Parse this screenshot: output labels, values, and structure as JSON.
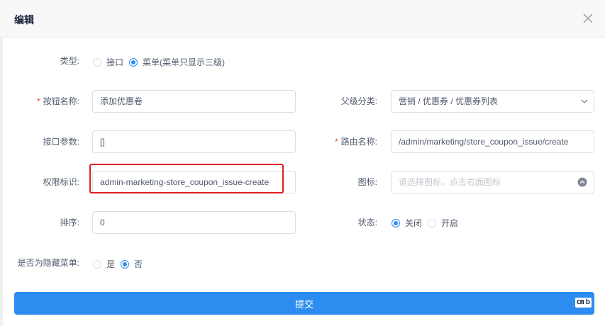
{
  "dialog": {
    "title": "编辑"
  },
  "form": {
    "type": {
      "label": "类型:",
      "options": [
        {
          "label": "接口",
          "selected": false
        },
        {
          "label": "菜单(菜单只显示三级)",
          "selected": true
        }
      ]
    },
    "button_name": {
      "label": "按钮名称:",
      "required": "*",
      "value": "添加优惠卷"
    },
    "parent_category": {
      "label": "父级分类:",
      "value": "营销 / 优惠券 / 优惠券列表"
    },
    "api_params": {
      "label": "接口参数:",
      "value": "[]"
    },
    "route_name": {
      "label": "路由名称:",
      "required": "*",
      "value": "/admin/marketing/store_coupon_issue/create"
    },
    "permission": {
      "label": "权限标识:",
      "value": "admin-marketing-store_coupon_issue-create"
    },
    "icon": {
      "label": "图标:",
      "placeholder": "请选择图标，点击右面图标"
    },
    "sort": {
      "label": "排序:",
      "value": "0"
    },
    "status": {
      "label": "状态:",
      "options": [
        {
          "label": "关闭",
          "selected": true
        },
        {
          "label": "开启",
          "selected": false
        }
      ]
    },
    "hidden_menu": {
      "label": "是否为隐藏菜单:",
      "options": [
        {
          "label": "是",
          "selected": false
        },
        {
          "label": "否",
          "selected": true
        }
      ]
    }
  },
  "submit": {
    "label": "提交",
    "badge": "㎝ b"
  },
  "colors": {
    "primary": "#2d8cf0",
    "highlight": "#e02020",
    "required": "#ed4014"
  }
}
